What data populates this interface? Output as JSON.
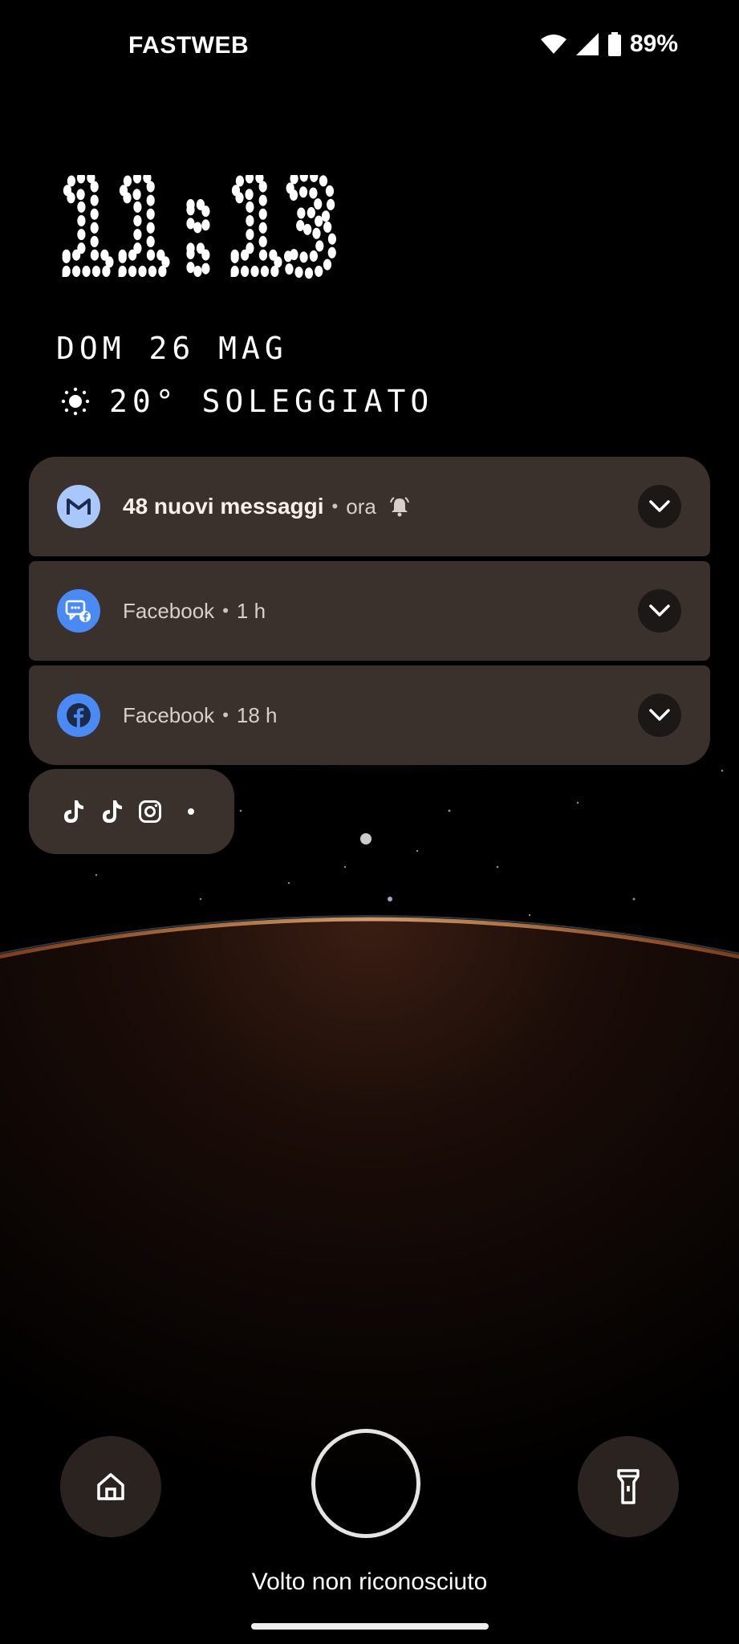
{
  "status_bar": {
    "carrier": "FASTWEB",
    "battery": "89%",
    "icons": [
      "wifi-icon",
      "signal-icon",
      "battery-icon"
    ]
  },
  "lock_clock": {
    "time": "11:13",
    "date": "DOM 26 MAG",
    "weather": "20° SOLEGGIATO",
    "weather_icon": "sun-icon"
  },
  "notifications": [
    {
      "app_icon": "gmail-icon",
      "title": "48 nuovi messaggi",
      "time": "ora",
      "extra_icon": "bell-icon",
      "icon_bg": "#a8c7fa"
    },
    {
      "app_icon": "facebook-messenger-icon",
      "title": "Facebook",
      "time": "1 h",
      "icon_bg": "#4a8af4"
    },
    {
      "app_icon": "facebook-icon",
      "title": "Facebook",
      "time": "18 h",
      "icon_bg": "#4a8af4"
    }
  ],
  "notification_overflow_icons": [
    "tiktok-icon",
    "tiktok-icon",
    "instagram-icon"
  ],
  "bottom": {
    "left_shortcut": "home-icon",
    "right_shortcut": "flashlight-icon",
    "face_message": "Volto non riconosciuto"
  },
  "colors": {
    "notification_bg": "#3a312c",
    "accent_blue": "#4a8af4",
    "gmail_bg": "#a8c7fa"
  }
}
